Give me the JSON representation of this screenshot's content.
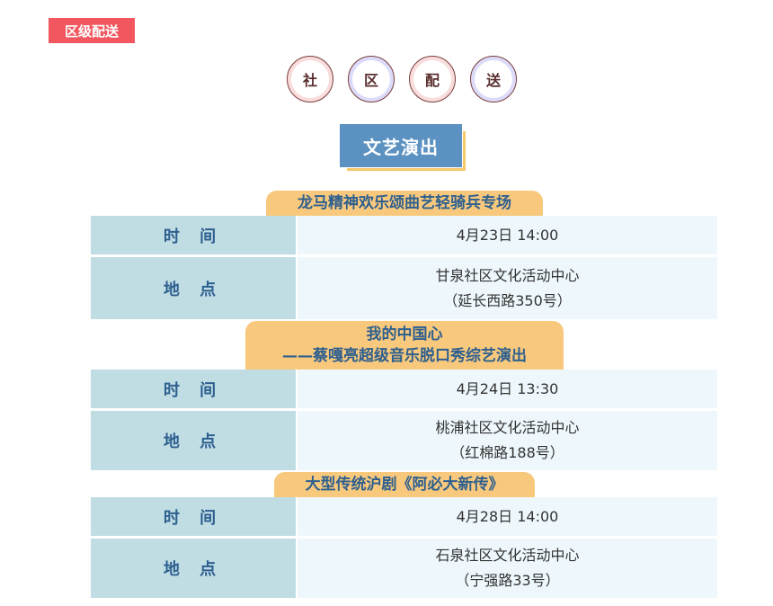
{
  "tag": "区级配送",
  "circles": [
    "社",
    "区",
    "配",
    "送"
  ],
  "section_title": "文艺演出",
  "labels": {
    "time": "时 间",
    "place": "地 点"
  },
  "events": [
    {
      "title": [
        "龙马精神欢乐颂曲艺轻骑兵专场"
      ],
      "time": "4月23日 14:00",
      "venue": "甘泉社区文化活动中心",
      "address": "（延长西路350号）"
    },
    {
      "title": [
        "我的中国心",
        "——蔡嘎亮超级音乐脱口秀综艺演出"
      ],
      "time": "4月24日 13:30",
      "venue": "桃浦社区文化活动中心",
      "address": "（红棉路188号）"
    },
    {
      "title": [
        "大型传统沪剧《阿必大新传》"
      ],
      "time": "4月28日 14:00",
      "venue": "石泉社区文化活动中心",
      "address": "（宁强路33号）"
    }
  ]
}
